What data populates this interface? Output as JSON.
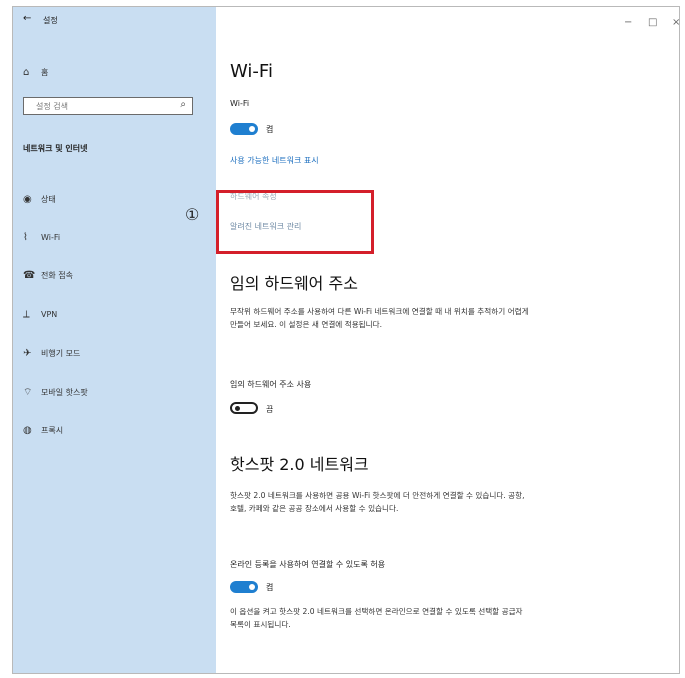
{
  "titlebar": {
    "back_glyph": "←",
    "app_title": "설정"
  },
  "window_controls": {
    "minimize": "−",
    "maximize": "□",
    "close": "×"
  },
  "sidebar": {
    "home_label": "홈",
    "search_placeholder": "설정 검색",
    "section_title": "네트워크 및 인터넷",
    "items": [
      {
        "label": "상태",
        "icon": "status-icon",
        "glyph": "◉"
      },
      {
        "label": "Wi-Fi",
        "icon": "wifi-icon",
        "glyph": "⌇"
      },
      {
        "label": "전화 접속",
        "icon": "dialup-icon",
        "glyph": "☎"
      },
      {
        "label": "VPN",
        "icon": "vpn-icon",
        "glyph": "⟂"
      },
      {
        "label": "비행기 모드",
        "icon": "airplane-icon",
        "glyph": "✈"
      },
      {
        "label": "모바일 핫스팟",
        "icon": "hotspot-icon",
        "glyph": "⌔"
      },
      {
        "label": "프록시",
        "icon": "proxy-icon",
        "glyph": "◍"
      }
    ]
  },
  "main": {
    "title": "Wi-Fi",
    "wifi_label": "Wi-Fi",
    "wifi_toggle_state": "켬",
    "show_networks_link": "사용 가능한 네트워크 표시",
    "hidden_link_partial": "하드웨어 속성",
    "manage_networks_link": "알려진 네트워크 관리",
    "annotation_marker": "①",
    "random_hw": {
      "heading": "임의 하드웨어 주소",
      "desc": "무작위 하드웨어 주소를 사용하여 다른 Wi-Fi 네트워크에 연결할 때 내 위치를 추적하기 어렵게 만들어 보세요. 이 설정은 새 연결에 적용됩니다.",
      "toggle_label": "임의 하드웨어 주소 사용",
      "toggle_state": "끔"
    },
    "hotspot20": {
      "heading": "핫스팟 2.0 네트워크",
      "desc": "핫스팟 2.0 네트워크를 사용하면 공용 Wi-Fi 핫스팟에 더 안전하게 연결할 수 있습니다. 공항, 호텔, 카페와 같은 공공 장소에서 사용할 수 있습니다.",
      "toggle_label": "온라인 등록을 사용하여 연결할 수 있도록 허용",
      "toggle_state": "켬",
      "note": "이 옵션을 켜고 핫스팟 2.0 네트워크를 선택하면 온라인으로 연결할 수 있도록 선택할 공급자 목록이 표시됩니다."
    }
  },
  "colors": {
    "sidebar_bg": "#c9def2",
    "accent": "#1f7fd0",
    "link": "#1d6fbf",
    "annotation": "#d41f2a"
  }
}
